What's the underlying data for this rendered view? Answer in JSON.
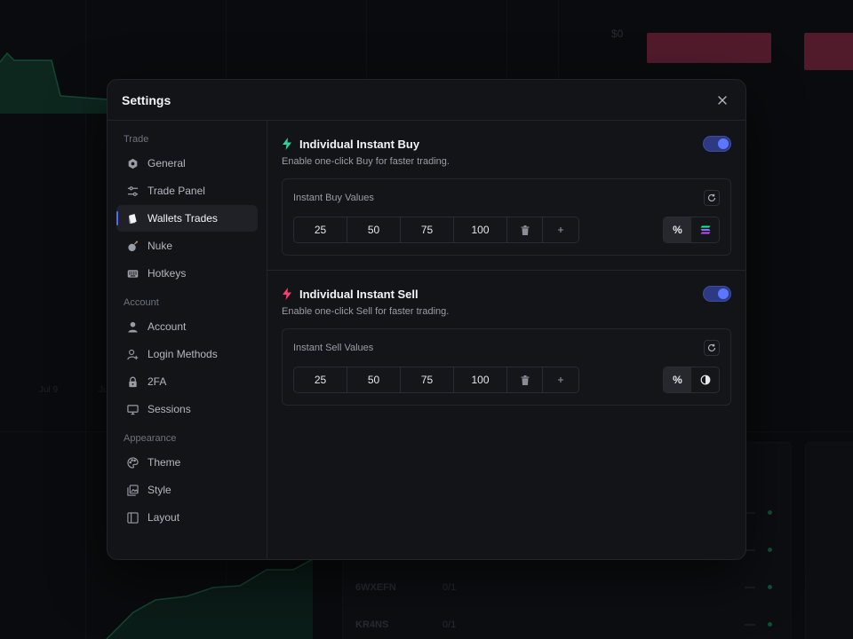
{
  "background": {
    "price_label": "$0",
    "dates": [
      "Jul 9",
      "Ju"
    ],
    "rows": [
      {
        "ticker": "6WXEFN",
        "count": "0/1"
      },
      {
        "ticker": "KR4NS",
        "count": "0/1"
      }
    ]
  },
  "modal": {
    "title": "Settings",
    "close_icon": "close-icon"
  },
  "sidebar": {
    "sections": [
      {
        "label": "Trade",
        "items": [
          {
            "label": "General",
            "icon": "hexagon-gear-icon"
          },
          {
            "label": "Trade Panel",
            "icon": "sliders-icon"
          },
          {
            "label": "Wallets Trades",
            "icon": "wallet-cards-icon",
            "active": true
          },
          {
            "label": "Nuke",
            "icon": "bomb-icon"
          },
          {
            "label": "Hotkeys",
            "icon": "keyboard-icon"
          }
        ]
      },
      {
        "label": "Account",
        "items": [
          {
            "label": "Account",
            "icon": "user-icon"
          },
          {
            "label": "Login Methods",
            "icon": "user-plus-icon"
          },
          {
            "label": "2FA",
            "icon": "lock-icon"
          },
          {
            "label": "Sessions",
            "icon": "monitor-icon"
          }
        ]
      },
      {
        "label": "Appearance",
        "items": [
          {
            "label": "Theme",
            "icon": "palette-icon"
          },
          {
            "label": "Style",
            "icon": "image-stack-icon"
          },
          {
            "label": "Layout",
            "icon": "layout-icon"
          }
        ]
      }
    ]
  },
  "settings": {
    "buy": {
      "title": "Individual Instant Buy",
      "description": "Enable one-click Buy for faster trading.",
      "enabled": true,
      "accent": "#2fd49a",
      "values_label": "Instant Buy Values",
      "values": [
        "25",
        "50",
        "75",
        "100"
      ],
      "unit_percent": "%"
    },
    "sell": {
      "title": "Individual Instant Sell",
      "description": "Enable one-click Sell for faster trading.",
      "enabled": true,
      "accent": "#ff3d6e",
      "values_label": "Instant Sell Values",
      "values": [
        "25",
        "50",
        "75",
        "100"
      ],
      "unit_percent": "%"
    }
  },
  "colors": {
    "toggle_on": "#5b77ff",
    "active_indicator": "#4f6bf5"
  }
}
